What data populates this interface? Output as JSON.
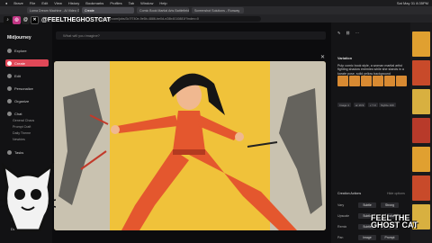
{
  "menubar": {
    "items": [
      "Brave",
      "File",
      "Edit",
      "View",
      "History",
      "Bookmarks",
      "Profiles",
      "Tab",
      "Window",
      "Help"
    ],
    "clock": "Sat May 31 8:35PM"
  },
  "tabs": [
    "Luma Dream Machine - AI Video G...",
    "Create",
    "Comic Book Martial Arts Battlefield...",
    "Screenshot Solutions - Runway"
  ],
  "url": "midjourney.com/jobs/3c7f740e-9e5b-4886-be0d-e28b4010881f?index=0",
  "overlay": {
    "handle": "@FEELTHEGHOSTCAT"
  },
  "sidebar": {
    "logo": "Midjourney",
    "items": [
      "Explore",
      "Create",
      "Edit",
      "Personalize",
      "Organize",
      "Chat",
      "Tasks"
    ],
    "chat_rooms": [
      "General Chaos",
      "Prompt Craft",
      "Daily Theme",
      "Newbies"
    ],
    "bottom": [
      "Updates",
      "Dark Mode"
    ]
  },
  "prompt": {
    "placeholder": "What will you imagine?"
  },
  "panel": {
    "title": "Variation",
    "description": "Pulp comic book style, a woman martial artist fighting shadow enemies while she stands in a karate pose, solid yellow background",
    "chips": [
      "Image 4",
      "ar 16:9",
      "v 7.0",
      "Stylize 100"
    ],
    "creation_actions": "Creation Actions",
    "hide_options": "Hide options",
    "rows": [
      {
        "label": "Vary",
        "buttons": [
          "Subtle",
          "Strong"
        ]
      },
      {
        "label": "Upscale",
        "buttons": [
          "Subtle",
          "Creative"
        ]
      },
      {
        "label": "Remix",
        "buttons": [
          "Subtle",
          "Strong"
        ]
      },
      {
        "label": "Pan",
        "buttons": [
          "Image",
          "Prompt"
        ]
      }
    ]
  },
  "watermark": "FEEL THE GHOST CAT",
  "colors": {
    "accent": "#e04858",
    "art_bg": "#f0c23a",
    "suit": "#e4572e"
  }
}
